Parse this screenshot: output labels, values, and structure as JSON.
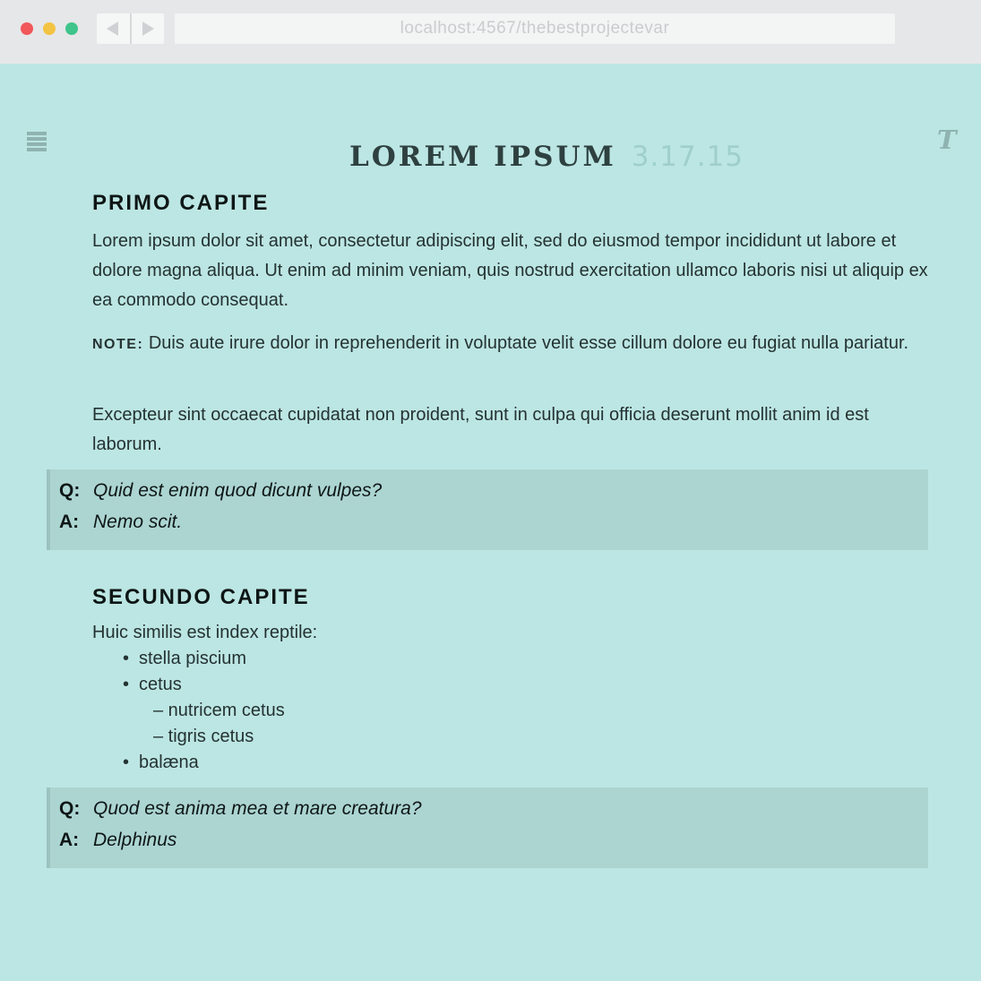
{
  "browser": {
    "url": "localhost:4567/thebestprojectevar"
  },
  "header": {
    "title": "LOREM IPSUM",
    "date": "3.17.15"
  },
  "section1": {
    "heading": "PRIMO CAPITE",
    "paragraph1": "Lorem ipsum dolor sit amet, consectetur adipiscing elit, sed do eiusmod tempor incididunt ut labore et dolore magna aliqua. Ut enim ad minim veniam, quis nostrud exercitation ullamco laboris nisi ut aliquip ex ea commodo consequat.",
    "note_label": "NOTE:",
    "note_text": " Duis aute irure dolor in reprehenderit in voluptate velit esse cillum dolore eu fugiat nulla pariatur.",
    "paragraph3": "Excepteur sint occaecat cupidatat non proident, sunt in culpa qui officia deserunt mollit anim id est laborum.",
    "qa": {
      "q_label": "Q:",
      "question": "Quid est enim quod dicunt vulpes?",
      "a_label": "A:",
      "answer": "Nemo scit."
    }
  },
  "section2": {
    "heading": "SECUNDO CAPITE",
    "intro": "Huic similis est index reptile:",
    "items": [
      "stella piscium",
      "cetus",
      "balæna"
    ],
    "subitems": [
      "– nutricem cetus",
      "– tigris cetus"
    ],
    "qa": {
      "q_label": "Q:",
      "question": "Quod est anima mea et mare creatura?",
      "a_label": "A:",
      "answer": "Delphinus"
    }
  },
  "icons": {
    "menu": "hamburger-menu-icon",
    "typography": "T"
  },
  "colors": {
    "page_background": "#bce6e3",
    "callout_background": "#acd5d2",
    "chrome_background": "#e6e7e8"
  }
}
